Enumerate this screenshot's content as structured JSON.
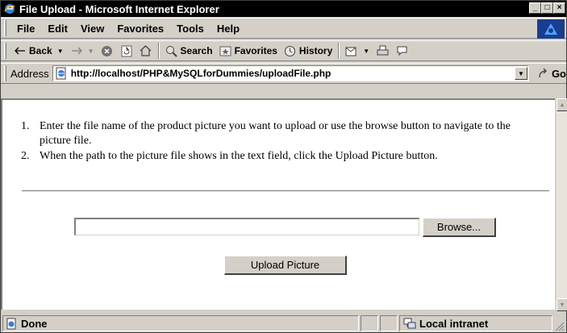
{
  "window": {
    "title": "File Upload - Microsoft Internet Explorer",
    "controls": {
      "minimize": "_",
      "maximize": "□",
      "close": "×"
    }
  },
  "menubar": {
    "items": [
      "File",
      "Edit",
      "View",
      "Favorites",
      "Tools",
      "Help"
    ],
    "brand_icon": "ie-throbber-icon"
  },
  "toolbar": {
    "back_label": "Back",
    "search_label": "Search",
    "favorites_label": "Favorites",
    "history_label": "History"
  },
  "address": {
    "label": "Address",
    "url": "http://localhost/PHP&MySQLforDummies/uploadFile.php",
    "go_label": "Go"
  },
  "page": {
    "instructions": [
      {
        "num": "1.",
        "text": "Enter the file name of the product picture you want to upload or use the browse button to navigate to the picture file."
      },
      {
        "num": "2.",
        "text": "When the path to the picture file shows in the text field, click the Upload Picture button."
      }
    ],
    "file_input_value": "",
    "browse_label": "Browse...",
    "upload_label": "Upload Picture"
  },
  "status": {
    "text": "Done",
    "zone": "Local intranet"
  },
  "colors": {
    "title_bg": "#000000",
    "chrome": "#d4d0c8",
    "brand_blue": "#1a3d8f"
  }
}
